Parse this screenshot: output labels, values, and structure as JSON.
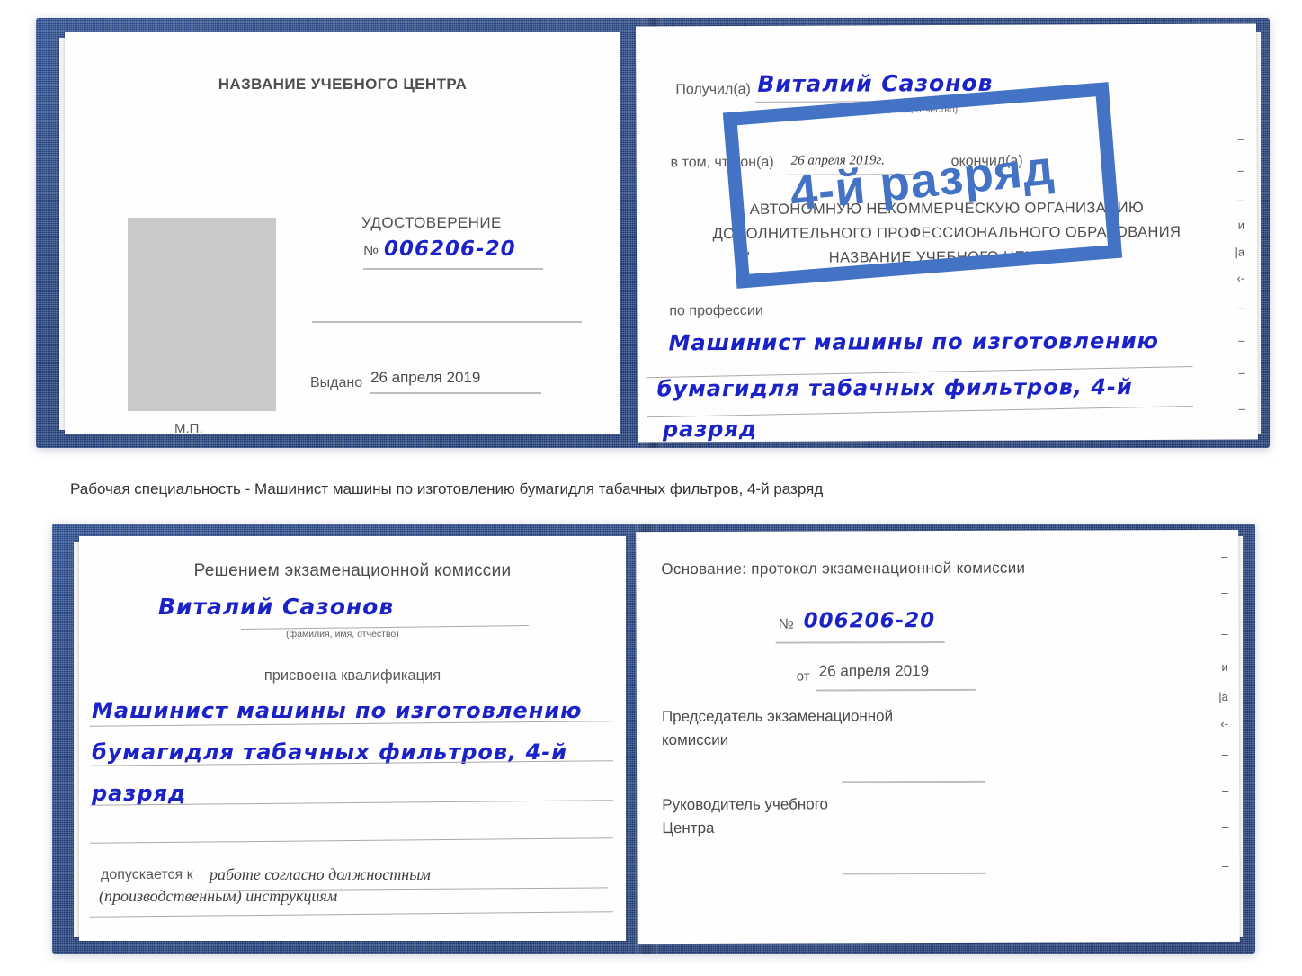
{
  "caption": {
    "text": "Рабочая специальность - Машинист машины по изготовлению бумагидля табачных фильтров, 4-й разряд"
  },
  "watermark": {
    "label": "4-й разряд",
    "color": "#4472c4"
  },
  "colors": {
    "cover": "#23427f",
    "handwriting": "#1b22c8",
    "print": "#595959",
    "accent": "#4472c4",
    "photo_placeholder": "#c9c9c9"
  },
  "certificate_top": {
    "left_page": {
      "center_name": "НАЗВАНИЕ УЧЕБНОГО ЦЕНТРА",
      "doc_title": "УДОСТОВЕРЕНИЕ",
      "number_symbol": "№",
      "number_value": "006206-20",
      "issued_label": "Выдано",
      "issued_value": "26 апреля 2019",
      "seal_label": "М.П.",
      "photo_alt": "photo-placeholder"
    },
    "right_page": {
      "received_label": "Получил(а)",
      "received_value": "Виталий Сазонов",
      "received_hint": "(фамилия, имя, отчество)",
      "in_that_label": "в том, что он(а)",
      "date_value": "26 апреля 2019г.",
      "finished_label": "окончил(а)",
      "org_line_1": "АВТОНОМНУЮ НЕКОММЕРЧЕСКУЮ ОРГАНИЗАЦИЮ",
      "org_line_2": "ДОПОЛНИТЕЛЬНОГО ПРОФЕССИОНАЛЬНОГО ОБРАЗОВАНИЯ",
      "org_quote_open": "\"",
      "org_line_3": "НАЗВАНИЕ УЧЕБНОГО ЦЕНТРА",
      "org_quote_close": "\"",
      "profession_label": "по профессии",
      "profession_line_1": "Машинист машины по изготовлению",
      "profession_line_2": "бумагидля табачных фильтров, 4-й",
      "profession_line_3": "разряд",
      "edge_fragments": [
        "–",
        "–",
        "–",
        "и",
        "|а",
        "‹-",
        "–",
        "–",
        "–",
        "–"
      ]
    }
  },
  "certificate_bottom": {
    "left_page": {
      "heading": "Решением экзаменационной комиссии",
      "name_value": "Виталий Сазонов",
      "name_hint": "(фамилия, имя, отчество)",
      "qualification_label": "присвоена квалификация",
      "qualification_line_1": "Машинист машины по изготовлению",
      "qualification_line_2": "бумагидля табачных фильтров, 4-й",
      "qualification_line_3": "разряд",
      "admitted_label": "допускается к",
      "admitted_value_1": "работе согласно должностным",
      "admitted_value_2": "(производственным) инструкциям"
    },
    "right_page": {
      "basis_label": "Основание: протокол экзаменационной комиссии",
      "number_symbol": "№",
      "number_value": "006206-20",
      "from_label": "от",
      "from_value": "26 апреля 2019",
      "chairman_line_1": "Председатель экзаменационной",
      "chairman_line_2": "комиссии",
      "head_line_1": "Руководитель учебного",
      "head_line_2": "Центра",
      "edge_fragments": [
        "–",
        "–",
        "–",
        "и",
        "|а",
        "‹-",
        "–",
        "–",
        "–",
        "–"
      ]
    }
  }
}
